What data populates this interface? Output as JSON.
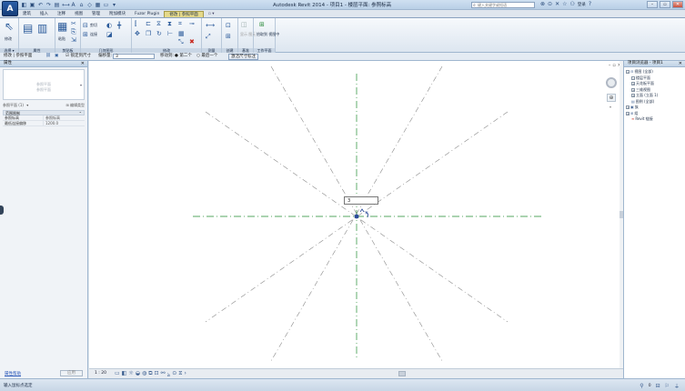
{
  "app": {
    "logo_letter": "A",
    "title": "Autodesk Revit 2014 -",
    "title_project": "项目1 - 楼层平面: 参照标高",
    "search_placeholder": "键入关键字或短语",
    "login": "登录"
  },
  "qat_icons": [
    "open-icon",
    "save-icon",
    "undo-icon",
    "redo-icon",
    "print-icon",
    "measure-icon",
    "text-icon",
    "3d-icon",
    "section-icon",
    "thin-lines-icon",
    "close-windows-icon",
    "more-icon"
  ],
  "ribbon_tabs": [
    {
      "label": "建筑",
      "active": false
    },
    {
      "label": "插入",
      "active": false
    },
    {
      "label": "注释",
      "active": false
    },
    {
      "label": "视图",
      "active": false
    },
    {
      "label": "管理",
      "active": false
    },
    {
      "label": "附加模块",
      "active": false
    },
    {
      "label": "Fuzor Plugin",
      "active": false
    },
    {
      "label": "修改 | 参照平面",
      "active": true,
      "context": true
    },
    {
      "label": "▫ ▾",
      "active": false
    }
  ],
  "ribbon_panels": {
    "select": {
      "label": "选择 ▾",
      "modify": "修改"
    },
    "properties": {
      "label": "属性"
    },
    "clipboard": {
      "label": "剪贴板",
      "paste": "粘贴"
    },
    "geometry": {
      "label": "几何图形",
      "cut": "剪切",
      "join": "连接"
    },
    "modify": {
      "label": "修改"
    },
    "measure": {
      "label": "测量"
    },
    "create": {
      "label": "创建"
    },
    "modify_reference": {
      "label": "基准",
      "hide": "显示\n图元"
    },
    "work_plane": {
      "label": "工作平面",
      "pick": "拾取到\n视图中"
    }
  },
  "options_bar": {
    "context": "修改 | 参照平面",
    "constraint_label": "☑ 锁定到尺寸",
    "offset_label": "偏移量:",
    "offset_value": "3",
    "move_label": "移动到:",
    "radio1": "● 第二个",
    "radio2": "○ 最后一个",
    "dim_btn": "激活尺寸标注"
  },
  "properties": {
    "title": "属性",
    "type_line1": "参照平面",
    "type_line2": "参照平面",
    "filter": "参照平面 (1)",
    "edit_type": "编辑类型",
    "section": "范围限制",
    "rows": [
      {
        "key": "参照标高",
        "value": "参照标高"
      },
      {
        "key": "最低连接偏移",
        "value": "1200.0"
      }
    ],
    "help": "属性帮助",
    "apply": "应用"
  },
  "canvas": {
    "dim_value": "3",
    "dim_label": "平"
  },
  "view_bar": {
    "scale": "1 : 20"
  },
  "browser": {
    "title": "项目浏览器 - 项目1",
    "nodes": [
      {
        "level": 0,
        "exp": "−",
        "icon": "views-icon",
        "label": "视图 (全部)"
      },
      {
        "level": 1,
        "exp": "−",
        "icon": "",
        "label": "楼层平面"
      },
      {
        "level": 1,
        "exp": "+",
        "icon": "",
        "label": "天花板平面"
      },
      {
        "level": 1,
        "exp": "+",
        "icon": "",
        "label": "三维视图"
      },
      {
        "level": 1,
        "exp": "+",
        "icon": "",
        "label": "立面 (立面 1)"
      },
      {
        "level": 0,
        "exp": "",
        "icon": "legend-icon",
        "label": "图例 (全部)"
      },
      {
        "level": 0,
        "exp": "+",
        "icon": "family-icon",
        "label": "族"
      },
      {
        "level": 0,
        "exp": "+",
        "icon": "group-icon",
        "label": "组"
      },
      {
        "level": 0,
        "exp": "",
        "icon": "revit-link-icon",
        "label": "Revit 链接"
      }
    ]
  },
  "status": {
    "text": "输入鼠标点选定",
    "zero": "0"
  }
}
